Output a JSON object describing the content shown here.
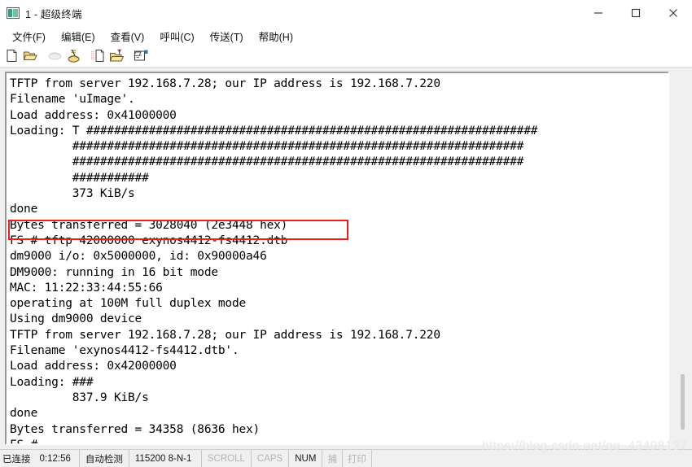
{
  "window": {
    "title": "1 - 超级终端",
    "icon": "terminal-icon",
    "accent_color": "#f2674a",
    "controls": [
      {
        "name": "minimize",
        "glyph": "minimize-icon"
      },
      {
        "name": "maximize",
        "glyph": "maximize-icon"
      },
      {
        "name": "close",
        "glyph": "close-icon"
      }
    ]
  },
  "menu": {
    "items": [
      {
        "label": "文件(F)",
        "name": "menu-file"
      },
      {
        "label": "编辑(E)",
        "name": "menu-edit"
      },
      {
        "label": "查看(V)",
        "name": "menu-view"
      },
      {
        "label": "呼叫(C)",
        "name": "menu-call"
      },
      {
        "label": "传送(T)",
        "name": "menu-transfer"
      },
      {
        "label": "帮助(H)",
        "name": "menu-help"
      }
    ]
  },
  "toolbar": {
    "buttons": [
      {
        "name": "new-connection-icon",
        "title": "新建连接"
      },
      {
        "name": "open-folder-icon",
        "title": "打开"
      },
      {
        "name": "disconnect-icon",
        "title": "断开",
        "disabled": true
      },
      {
        "name": "call-icon",
        "title": "呼叫"
      },
      {
        "name": "send-file-icon",
        "title": "发送文件"
      },
      {
        "name": "receive-file-icon",
        "title": "接收文件"
      },
      {
        "name": "properties-icon",
        "title": "属性"
      }
    ]
  },
  "terminal": {
    "lines": [
      "TFTP from server 192.168.7.28; our IP address is 192.168.7.220",
      "Filename 'uImage'.",
      "Load address: 0x41000000",
      "Loading: T #################################################################",
      "         #################################################################",
      "         #################################################################",
      "         ###########",
      "         373 KiB/s",
      "done",
      "Bytes transferred = 3028040 (2e3448 hex)",
      "FS # tftp 42000000 exynos4412-fs4412.dtb",
      "dm9000 i/o: 0x5000000, id: 0x90000a46",
      "DM9000: running in 16 bit mode",
      "MAC: 11:22:33:44:55:66",
      "operating at 100M full duplex mode",
      "Using dm9000 device",
      "TFTP from server 192.168.7.28; our IP address is 192.168.7.220",
      "Filename 'exynos4412-fs4412.dtb'.",
      "Load address: 0x42000000",
      "Loading: ###",
      "         837.9 KiB/s",
      "done",
      "Bytes transferred = 34358 (8636 hex)",
      "FS # "
    ],
    "highlight": {
      "name": "command-highlight-box",
      "text": "FS # tftp 42000000 exynos4412-fs4412.dtb",
      "color": "#f41b1b"
    },
    "scrollbar": {
      "name": "terminal-vertical-scrollbar"
    }
  },
  "status_bar": {
    "connection_state": "已连接",
    "elapsed_time": "0:12:56",
    "detection": "自动检测",
    "serial_settings": "115200 8-N-1",
    "indicators": [
      {
        "label": "SCROLL",
        "active": false
      },
      {
        "label": "CAPS",
        "active": false
      },
      {
        "label": "NUM",
        "active": true
      },
      {
        "label": "捕",
        "active": false
      },
      {
        "label": "打印",
        "active": false
      }
    ]
  },
  "watermark": {
    "text": "https://blog.csdn.net/qq_43498137"
  }
}
